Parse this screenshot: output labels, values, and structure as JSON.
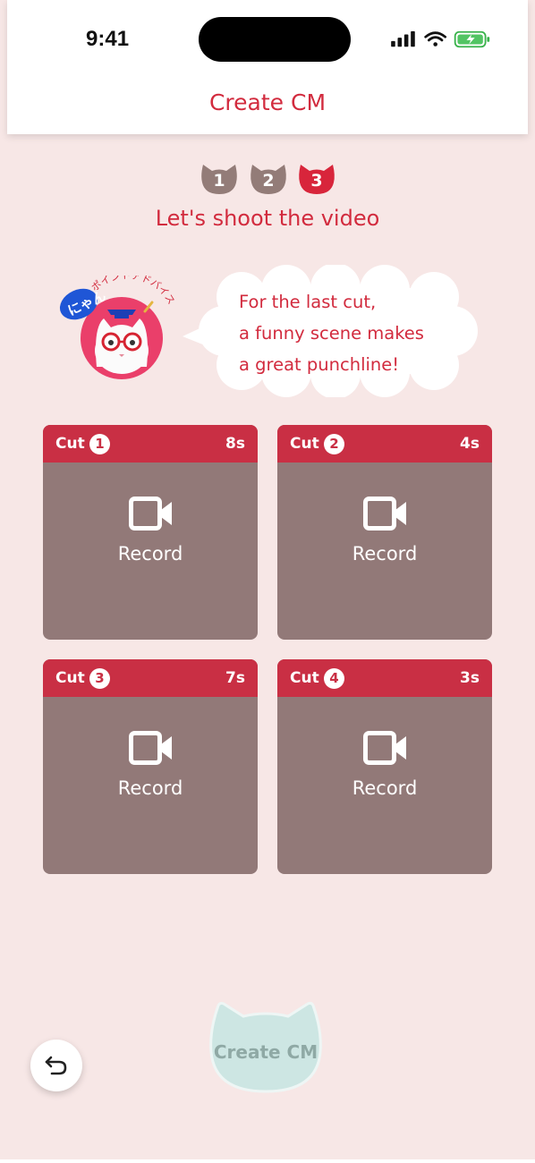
{
  "status_bar": {
    "time": "9:41"
  },
  "header": {
    "title": "Create CM"
  },
  "steps": [
    {
      "number": "1",
      "color": "#937c78",
      "active": false
    },
    {
      "number": "2",
      "color": "#937c78",
      "active": false
    },
    {
      "number": "3",
      "color": "#d8253b",
      "active": true
    }
  ],
  "heading": "Let's shoot the video",
  "advice": {
    "badge_text": "にゃん",
    "badge_caption": "ポイントアドバイス",
    "lines": [
      "For the last cut,",
      "a funny scene makes",
      "a great punchline!"
    ]
  },
  "cuts": [
    {
      "label": "Cut",
      "number": "1",
      "duration": "8s",
      "action": "Record"
    },
    {
      "label": "Cut",
      "number": "2",
      "duration": "4s",
      "action": "Record"
    },
    {
      "label": "Cut",
      "number": "3",
      "duration": "7s",
      "action": "Record"
    },
    {
      "label": "Cut",
      "number": "4",
      "duration": "3s",
      "action": "Record"
    }
  ],
  "footer": {
    "create_label": "Create CM",
    "back_icon": "undo-arrow-icon"
  },
  "colors": {
    "accent": "#d22b3e",
    "card_header": "#c92f44",
    "card_body": "#927978",
    "background": "#f7e7e6",
    "create_button": "#cde6e3"
  }
}
